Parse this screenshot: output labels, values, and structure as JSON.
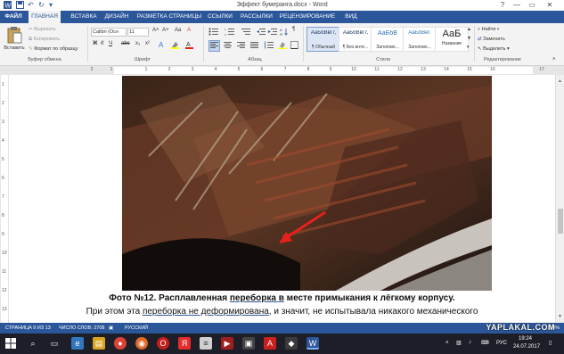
{
  "window": {
    "title": "Эффект бумеранга.docx - Word",
    "help": "?",
    "minimize": "—",
    "restore": "▭",
    "close": "✕"
  },
  "tabs": [
    "ФАЙЛ",
    "ГЛАВНАЯ",
    "ВСТАВКА",
    "ДИЗАЙН",
    "РАЗМЕТКА СТРАНИЦЫ",
    "ССЫЛКИ",
    "РАССЫЛКИ",
    "РЕЦЕНЗИРОВАНИЕ",
    "ВИД"
  ],
  "ribbon": {
    "clipboard": {
      "paste": "Вставить",
      "cut": "Вырезать",
      "copy": "Копировать",
      "format_painter": "Формат по образцу",
      "label": "Буфер обмена"
    },
    "font": {
      "family": "Calibri (Осн",
      "size": "11",
      "bold": "Ж",
      "italic": "К",
      "underline": "Ч",
      "strike": "abc",
      "sub": "x₂",
      "sup": "x²",
      "grow": "A˄",
      "shrink": "A˅",
      "case": "Aa",
      "clear": "A",
      "label": "Шрифт"
    },
    "paragraph": {
      "label": "Абзац",
      "marks": "¶"
    },
    "styles": {
      "label": "Стили",
      "items": [
        {
          "preview": "АаБбВвГг,",
          "name": "¶ Обычный"
        },
        {
          "preview": "АаБбВвГг,",
          "name": "¶ Без инте..."
        },
        {
          "preview": "АаБбВ",
          "name": "Заголово..."
        },
        {
          "preview": "АаБбВеГ",
          "name": "Заголово..."
        },
        {
          "preview": "АаБ",
          "name": "Название"
        }
      ]
    },
    "editing": {
      "find": "Найти",
      "replace": "Заменить",
      "select": "Выделить",
      "label": "Редактирование"
    }
  },
  "ruler": {
    "numbers": [
      "2",
      "1",
      "1",
      "2",
      "3",
      "4",
      "5",
      "6",
      "7",
      "8",
      "9",
      "10",
      "11",
      "12",
      "13",
      "14",
      "15",
      "16",
      "17"
    ]
  },
  "vruler": {
    "numbers": [
      "1",
      "2",
      "3",
      "4",
      "5",
      "6",
      "7",
      "8",
      "9",
      "10",
      "11",
      "12",
      "13"
    ]
  },
  "document": {
    "caption": {
      "prefix": "Фото №12. Расплавленная ",
      "link": "переборка ",
      "mid": " в",
      "suffix": " месте примыкания к лёгкому корпусу."
    },
    "body": {
      "prefix": "При этом эта ",
      "link1": "переборка ",
      "mid": " не деформирована",
      "suffix": ", и значит, не испытывала никакого механического"
    }
  },
  "status": {
    "page": "СТРАНИЦА 9 ИЗ 13",
    "words": "ЧИСЛО СЛОВ: 2708",
    "language": "РУССКИЙ",
    "zoom": "164%"
  },
  "taskbar": {
    "lang": "РУС",
    "time": "19:24",
    "date": "24.07.2017"
  },
  "watermark": "YAPLAKAL.COM",
  "colors": {
    "accent": "#2b579a",
    "arrow": "#e8201c"
  }
}
